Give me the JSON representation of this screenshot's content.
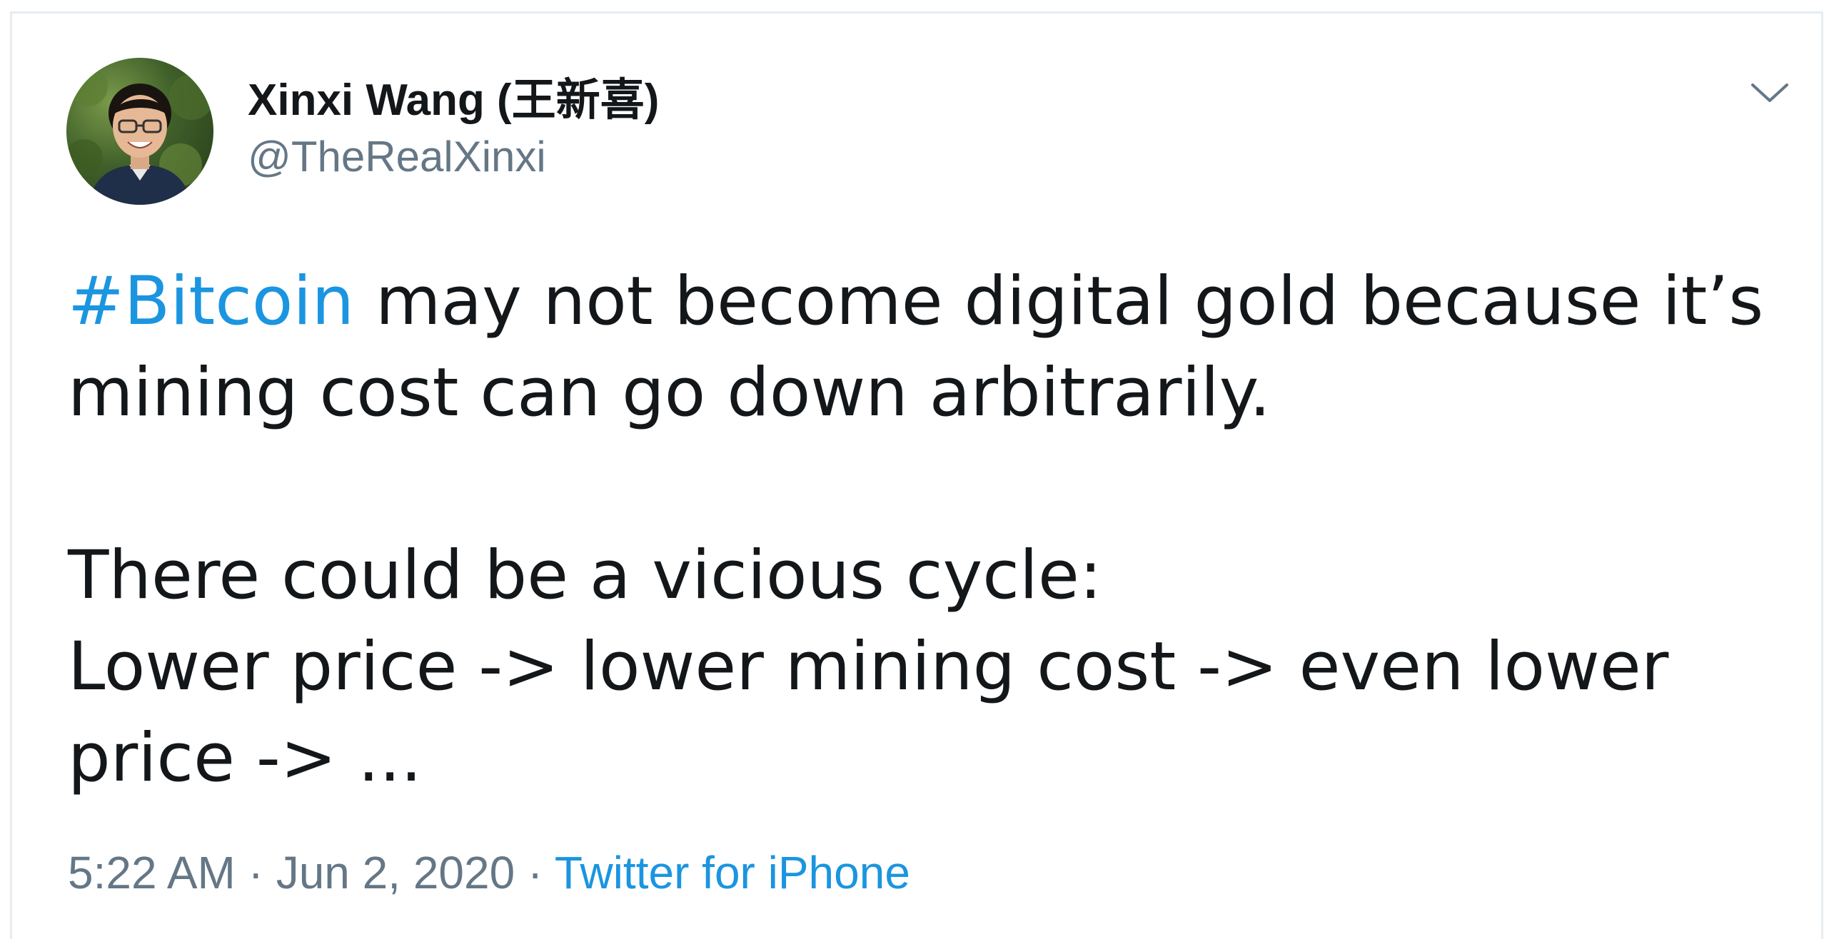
{
  "tweet": {
    "author": {
      "display_name": "Xinxi Wang (王新喜)",
      "handle": "@TheRealXinxi",
      "avatar_icon": "profile-photo"
    },
    "menu_icon": "chevron-down-icon",
    "hashtag": "#Bitcoin",
    "line1_rest": " may not become digital gold because it’s mining cost can go down arbitrarily.",
    "paragraph2": "There could be a vicious cycle:\nLower price -> lower mining cost -> even lower price -> ...",
    "timestamp": "5:22 AM",
    "separator": " · ",
    "date": "Jun 2, 2020",
    "source": "Twitter for iPhone"
  },
  "colors": {
    "link": "#1b95e0",
    "text": "#14171a",
    "secondary": "#657786",
    "border": "#e6ecf0"
  }
}
